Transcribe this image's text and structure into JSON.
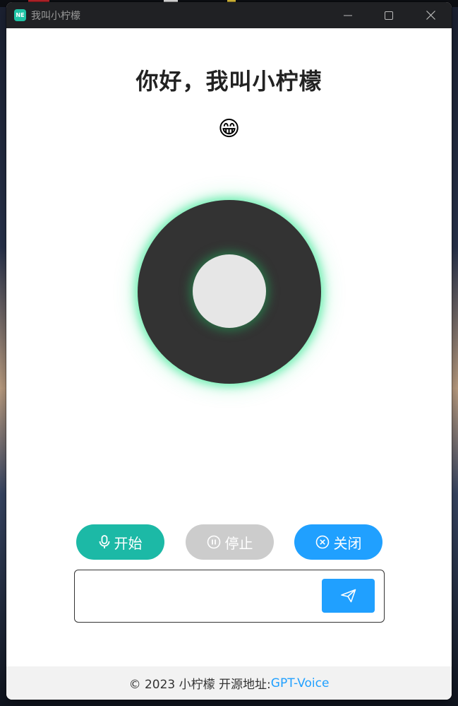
{
  "window": {
    "title": "我叫小柠檬",
    "app_icon_text": "NE"
  },
  "main": {
    "greeting": "你好，我叫小柠檬",
    "emoji": "😁"
  },
  "buttons": {
    "start_label": "开始",
    "stop_label": "停止",
    "close_label": "关闭"
  },
  "input": {
    "value": "",
    "placeholder": ""
  },
  "footer": {
    "copyright": "© 2023 小柠檬 开源地址:",
    "link_text": "GPT-Voice"
  },
  "colors": {
    "start": "#1cb9a6",
    "stop": "#cccccc",
    "close": "#20a0ff",
    "send": "#20a0ff",
    "glow": "#3ee896"
  },
  "icons": {
    "start": "microphone-icon",
    "stop": "pause-circle-icon",
    "close": "close-circle-icon",
    "send": "send-icon"
  }
}
